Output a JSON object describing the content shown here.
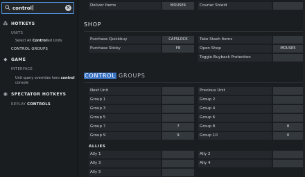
{
  "search": {
    "value": "control"
  },
  "sidebar": {
    "hotkeys": "HOTKEYS",
    "units": "UNITS",
    "select_all_pre": "Select All ",
    "select_all_hl": "Control",
    "select_all_post": "led Units",
    "control_groups": "CONTROL GROUPS",
    "game": "GAME",
    "interface": "INTERFACE",
    "unit_query_1": "Unit query overrides hero ",
    "unit_query_hl": "control",
    "unit_query_2": "console",
    "spectator_hotkeys": "SPECTATOR HOTKEYS",
    "replay_pre": "REPLAY ",
    "replay_hl": "CONTROLS"
  },
  "top_rows": [
    {
      "label": "Deliver Items",
      "key": "MOUSE4"
    },
    {
      "label": "Courier Shield",
      "key": ""
    }
  ],
  "shop": {
    "title": "SHOP",
    "left": [
      {
        "label": "Purchase Quickbuy",
        "key": "CAPSLOCK"
      },
      {
        "label": "Purchase Sticky",
        "key": "F8"
      }
    ],
    "right": [
      {
        "label": "Take Stash Items",
        "key": ""
      },
      {
        "label": "Open Shop",
        "key": "MOUSE5"
      },
      {
        "label": "Toggle Buyback Protection",
        "key": ""
      }
    ]
  },
  "control_groups": {
    "title_hl": "CONTROL",
    "title_rest": " GROUPS",
    "left": [
      {
        "label": "Next Unit",
        "key": ""
      },
      {
        "label": "Group 1",
        "key": ""
      },
      {
        "label": "Group 3",
        "key": ""
      },
      {
        "label": "Group 5",
        "key": ""
      },
      {
        "label": "Group 7",
        "key": "7"
      },
      {
        "label": "Group 9",
        "key": "9"
      }
    ],
    "right": [
      {
        "label": "Previous Unit",
        "key": ""
      },
      {
        "label": "Group 2",
        "key": ""
      },
      {
        "label": "Group 4",
        "key": ""
      },
      {
        "label": "Group 6",
        "key": ""
      },
      {
        "label": "Group 8",
        "key": "8"
      },
      {
        "label": "Group 10",
        "key": "0"
      }
    ]
  },
  "allies": {
    "title": "ALLIES",
    "left": [
      {
        "label": "Ally 1",
        "key": ""
      },
      {
        "label": "Ally 3",
        "key": ""
      },
      {
        "label": "Ally 5",
        "key": ""
      }
    ],
    "right": [
      {
        "label": "Ally 2",
        "key": ""
      },
      {
        "label": "Ally 4",
        "key": ""
      }
    ]
  },
  "colors": {
    "accent": "#3a73c4",
    "focus_border": "#4c8fd9"
  }
}
